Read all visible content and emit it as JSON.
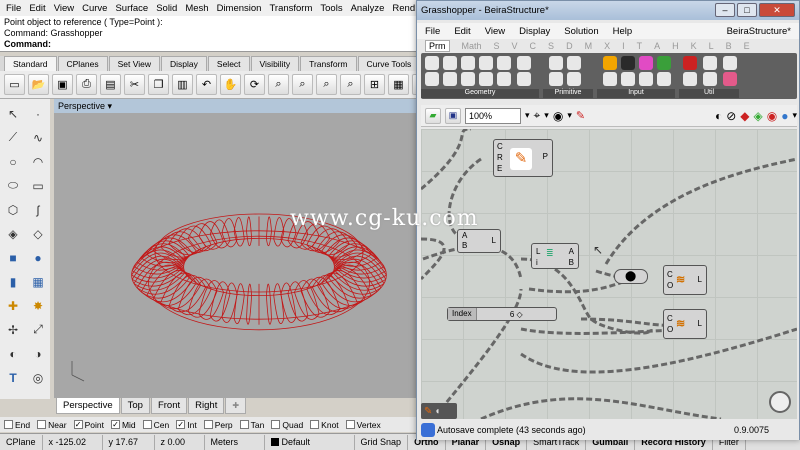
{
  "rhino": {
    "menus": [
      "File",
      "Edit",
      "View",
      "Curve",
      "Surface",
      "Solid",
      "Mesh",
      "Dimension",
      "Transform",
      "Tools",
      "Analyze",
      "Rend"
    ],
    "command_history": [
      "Point object to reference ( Type=Point ):",
      "Command: Grasshopper"
    ],
    "command_prompt": "Command:",
    "tool_tabs": [
      "Standard",
      "CPlanes",
      "Set View",
      "Display",
      "Select",
      "Visibility",
      "Transform",
      "Curve Tools",
      "Surfa"
    ],
    "viewport_title": "Perspective",
    "viewport_tabs": [
      "Perspective",
      "Top",
      "Front",
      "Right"
    ],
    "osnaps": [
      {
        "label": "End",
        "checked": false
      },
      {
        "label": "Near",
        "checked": false
      },
      {
        "label": "Point",
        "checked": true
      },
      {
        "label": "Mid",
        "checked": true
      },
      {
        "label": "Cen",
        "checked": false
      },
      {
        "label": "Int",
        "checked": true
      },
      {
        "label": "Perp",
        "checked": false
      },
      {
        "label": "Tan",
        "checked": false
      },
      {
        "label": "Quad",
        "checked": false
      },
      {
        "label": "Knot",
        "checked": false
      },
      {
        "label": "Vertex",
        "checked": false
      }
    ],
    "status": {
      "cplane": "CPlane",
      "x": "x -125.02",
      "y": "y 17.67",
      "z": "z 0.00",
      "units": "Meters",
      "layer": "Default",
      "buttons": [
        "Grid Snap",
        "Ortho",
        "Planar",
        "Osnap",
        "SmartTrack",
        "Gumball",
        "Record History",
        "Filter"
      ]
    }
  },
  "grasshopper": {
    "window_title": "Grasshopper - BeiraStructure*",
    "document_name": "BeiraStructure*",
    "menus": [
      "File",
      "Edit",
      "View",
      "Display",
      "Solution",
      "Help"
    ],
    "category_tabs": [
      "Prm",
      "Math",
      "S",
      "V",
      "C",
      "S",
      "D",
      "M",
      "X",
      "I",
      "T",
      "A",
      "H",
      "K",
      "L",
      "B",
      "E"
    ],
    "ribbon_groups": [
      "Geometry",
      "Primitive",
      "Input",
      "Util"
    ],
    "zoom": "100%",
    "nodes": {
      "point_node": {
        "inputs": [
          "C",
          "R",
          "E"
        ],
        "output": "P"
      },
      "ab_node": {
        "inputs": [
          "A",
          "B"
        ],
        "output": "L"
      },
      "lab_node": {
        "inputs": [
          "L",
          "i"
        ],
        "outputs": [
          "A",
          "B"
        ]
      },
      "co_node_1": {
        "inputs": [
          "C",
          "O"
        ],
        "output": "L"
      },
      "co_node_2": {
        "inputs": [
          "C",
          "O"
        ],
        "output": "L"
      }
    },
    "index_slider": {
      "label": "Index",
      "value": "6"
    },
    "status_message": "Autosave complete (43 seconds ago)",
    "version": "0.9.0075"
  },
  "watermark": "www.cg-ku.com",
  "colors": {
    "torus": "#c21818",
    "viewport_bg": "#a7a7a7",
    "canvas_bg": "#cfd3cf",
    "ribbon_bg": "#606060"
  }
}
